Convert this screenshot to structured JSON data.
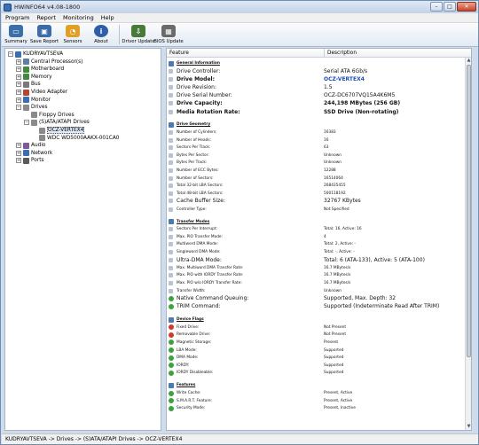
{
  "window": {
    "title": "HWiNFO64 v4.08-1800",
    "buttons": {
      "min": "–",
      "max": "□",
      "close": "✕"
    }
  },
  "menu": [
    "Program",
    "Report",
    "Monitoring",
    "Help"
  ],
  "toolbar": [
    {
      "label": "Summary",
      "icon": "monitor-icon",
      "color": "#3a6fa8"
    },
    {
      "label": "Save Report",
      "icon": "floppy-disk-icon",
      "color": "#3d6aa8"
    },
    {
      "label": "Sensors",
      "icon": "sensors-gauge-icon",
      "color": "#e0a028"
    },
    {
      "label": "About",
      "icon": "info-icon",
      "color": "#2d5fa8"
    },
    {
      "label": "Driver Update",
      "icon": "driver-update-icon",
      "color": "#4a7a3a"
    },
    {
      "label": "BIOS Update",
      "icon": "bios-chip-icon",
      "color": "#6a6a6a"
    }
  ],
  "tree": [
    {
      "label": "KUDRYAVTSEVA",
      "level": 0,
      "exp": "−",
      "icon": "computer-icon",
      "color": "#3a6fb5"
    },
    {
      "label": "Central Processor(s)",
      "level": 1,
      "exp": "+",
      "icon": "cpu-icon",
      "color": "#5b7fa6"
    },
    {
      "label": "Motherboard",
      "level": 1,
      "exp": "+",
      "icon": "motherboard-icon",
      "color": "#3f8a3f"
    },
    {
      "label": "Memory",
      "level": 1,
      "exp": "+",
      "icon": "memory-icon",
      "color": "#3f8a3f"
    },
    {
      "label": "Bus",
      "level": 1,
      "exp": "+",
      "icon": "bus-icon",
      "color": "#7a7a7a"
    },
    {
      "label": "Video Adapter",
      "level": 1,
      "exp": "+",
      "icon": "video-adapter-icon",
      "color": "#b5462f"
    },
    {
      "label": "Monitor",
      "level": 1,
      "exp": "+",
      "icon": "monitor-icon",
      "color": "#3a6fb5"
    },
    {
      "label": "Drives",
      "level": 1,
      "exp": "−",
      "icon": "drives-icon",
      "color": "#8a8a8a"
    },
    {
      "label": "Floppy Drives",
      "level": 2,
      "exp": "",
      "icon": "floppy-drive-icon",
      "color": "#8a8a8a"
    },
    {
      "label": "(S)ATA/ATAPI Drives",
      "level": 2,
      "exp": "−",
      "icon": "sata-drives-icon",
      "color": "#8a8a8a"
    },
    {
      "label": "OCZ-VERTEX4",
      "level": 3,
      "exp": "",
      "icon": "hard-disk-icon",
      "color": "#8a8a8a",
      "selected": true
    },
    {
      "label": "WDC WD5000AAKX-001CA0",
      "level": 3,
      "exp": "",
      "icon": "hard-disk-icon",
      "color": "#8a8a8a"
    },
    {
      "label": "Audio",
      "level": 1,
      "exp": "+",
      "icon": "audio-icon",
      "color": "#7a5a9a"
    },
    {
      "label": "Network",
      "level": 1,
      "exp": "+",
      "icon": "network-icon",
      "color": "#3a6fb5"
    },
    {
      "label": "Ports",
      "level": 1,
      "exp": "+",
      "icon": "ports-icon",
      "color": "#5a5a5a"
    }
  ],
  "columns": {
    "feature": "Feature",
    "description": "Description"
  },
  "rows": [
    {
      "type": "sec",
      "f": "General Information",
      "icon": "drive-icon"
    },
    {
      "type": "lg",
      "f": "Drive Controller:",
      "v": "Serial ATA 6Gb/s"
    },
    {
      "type": "lg",
      "f": "Drive Model:",
      "v": "OCZ-VERTEX4",
      "bold": true,
      "blue": true
    },
    {
      "type": "lg",
      "f": "Drive Revision:",
      "v": "1.5"
    },
    {
      "type": "lg",
      "f": "Drive Serial Number:",
      "v": "OCZ-DC6707VQ15A4K6M5"
    },
    {
      "type": "lg",
      "f": "Drive Capacity:",
      "v": "244,198 MBytes (256 GB)",
      "bold": true
    },
    {
      "type": "lg",
      "f": "Media Rotation Rate:",
      "v": "SSD Drive (Non-rotating)",
      "bold": true
    },
    {
      "type": "gap"
    },
    {
      "type": "sec",
      "f": "Drive Geometry",
      "icon": "drive-icon"
    },
    {
      "type": "sm",
      "f": "Number of Cylinders:",
      "v": "16383"
    },
    {
      "type": "sm",
      "f": "Number of Heads:",
      "v": "16"
    },
    {
      "type": "sm",
      "f": "Sectors Per Track:",
      "v": "63"
    },
    {
      "type": "sm",
      "f": "Bytes Per Sector:",
      "v": "Unknown"
    },
    {
      "type": "sm",
      "f": "Bytes Per Track:",
      "v": "Unknown"
    },
    {
      "type": "sm",
      "f": "Number of ECC Bytes:",
      "v": "12288"
    },
    {
      "type": "sm",
      "f": "Number of Sectors:",
      "v": "16514064"
    },
    {
      "type": "sm",
      "f": "Total 32-bit LBA Sectors:",
      "v": "268435455"
    },
    {
      "type": "sm",
      "f": "Total 48-bit LBA Sectors:",
      "v": "500118192"
    },
    {
      "type": "lg",
      "f": "Cache Buffer Size:",
      "v": "32767 KBytes"
    },
    {
      "type": "sm",
      "f": "Controller Type:",
      "v": "Not Specified"
    },
    {
      "type": "gap"
    },
    {
      "type": "sec",
      "f": "Transfer Modes",
      "icon": "drive-icon"
    },
    {
      "type": "sm",
      "f": "Sectors Per Interrupt:",
      "v": "Total: 16, Active: 16"
    },
    {
      "type": "sm",
      "f": "Max. PIO Transfer Mode:",
      "v": "4"
    },
    {
      "type": "sm",
      "f": "Multiword DMA Mode:",
      "v": "Total: 2, Active: -"
    },
    {
      "type": "sm",
      "f": "Singleword DMA Mode:",
      "v": "Total: -, Active: -"
    },
    {
      "type": "lg",
      "f": "Ultra-DMA Mode:",
      "v": "Total: 6 (ATA-133), Active: 5 (ATA-100)"
    },
    {
      "type": "sm",
      "f": "Max. Multiword DMA Transfer Rate:",
      "v": "16.7 MBytes/s"
    },
    {
      "type": "sm",
      "f": "Max. PIO with IORDY Transfer Rate:",
      "v": "16.7 MBytes/s"
    },
    {
      "type": "sm",
      "f": "Max. PIO w/o IORDY Transfer Rate:",
      "v": "16.7 MBytes/s"
    },
    {
      "type": "sm",
      "f": "Transfer Width:",
      "v": "Unknown"
    },
    {
      "type": "lg",
      "f": "Native Command Queuing:",
      "v": "Supported, Max. Depth: 32",
      "icon": "green-check-icon"
    },
    {
      "type": "lg",
      "f": "TRIM Command:",
      "v": "Supported (Indeterminate Read After TRIM)",
      "icon": "green-check-icon"
    },
    {
      "type": "gap"
    },
    {
      "type": "sec",
      "f": "Device Flags",
      "icon": "drive-icon"
    },
    {
      "type": "sm",
      "f": "Fixed Drive:",
      "v": "Not Present",
      "icon": "red-cross-icon"
    },
    {
      "type": "sm",
      "f": "Removable Drive:",
      "v": "Not Present",
      "icon": "red-cross-icon"
    },
    {
      "type": "sm",
      "f": "Magnetic Storage:",
      "v": "Present",
      "icon": "green-check-icon"
    },
    {
      "type": "sm",
      "f": "LBA Mode:",
      "v": "Supported",
      "icon": "green-check-icon"
    },
    {
      "type": "sm",
      "f": "DMA Mode:",
      "v": "Supported",
      "icon": "green-check-icon"
    },
    {
      "type": "sm",
      "f": "IORDY:",
      "v": "Supported",
      "icon": "green-check-icon"
    },
    {
      "type": "sm",
      "f": "IORDY Disableable:",
      "v": "Supported",
      "icon": "green-check-icon"
    },
    {
      "type": "gap"
    },
    {
      "type": "sec",
      "f": "Features",
      "icon": "drive-icon"
    },
    {
      "type": "sm",
      "f": "Write Cache:",
      "v": "Present, Active",
      "icon": "green-check-icon"
    },
    {
      "type": "sm",
      "f": "S.M.A.R.T. Feature:",
      "v": "Present, Active",
      "icon": "green-check-icon"
    },
    {
      "type": "sm",
      "f": "Security Mode:",
      "v": "Present, Inactive",
      "icon": "green-check-icon"
    }
  ],
  "status": "KUDRYAVTSEVA -> Drives -> (S)ATA/ATAPI Drives -> OCZ-VERTEX4"
}
